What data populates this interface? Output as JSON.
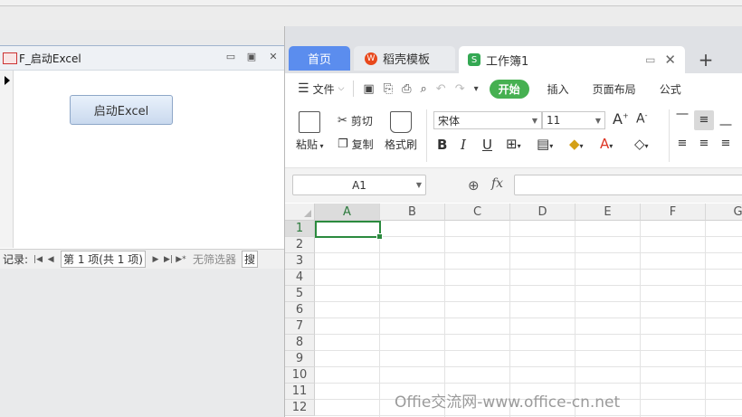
{
  "access": {
    "title": "F_启动Excel",
    "button_label": "启动Excel",
    "nav": {
      "record_label": "记录:",
      "position": "第 1 项(共 1 项)",
      "filter": "无筛选器",
      "search": "搜"
    }
  },
  "wps": {
    "tabs": {
      "home": "首页",
      "template": "稻壳模板",
      "workbook": "工作簿1",
      "template_icon_glyph": "W",
      "workbook_icon_glyph": "S"
    },
    "menu": {
      "file": "文件",
      "start": "开始",
      "insert": "插入",
      "page_layout": "页面布局",
      "formula": "公式"
    },
    "ribbon": {
      "paste": "粘贴",
      "cut": "剪切",
      "copy": "复制",
      "format_painter": "格式刷",
      "font_name": "宋体",
      "font_size": "11"
    },
    "name_box": "A1",
    "fx_label": "fx",
    "columns": [
      "A",
      "B",
      "C",
      "D",
      "E",
      "F",
      "G"
    ],
    "rows": [
      "1",
      "2",
      "3",
      "4",
      "5",
      "6",
      "7",
      "8",
      "9",
      "10",
      "11",
      "12"
    ]
  },
  "watermark": "Offie交流网-www.office-cn.net",
  "colors": {
    "home_tab": "#5b8dee",
    "start_button": "#46b051",
    "active_cell": "#2b8a3e"
  }
}
